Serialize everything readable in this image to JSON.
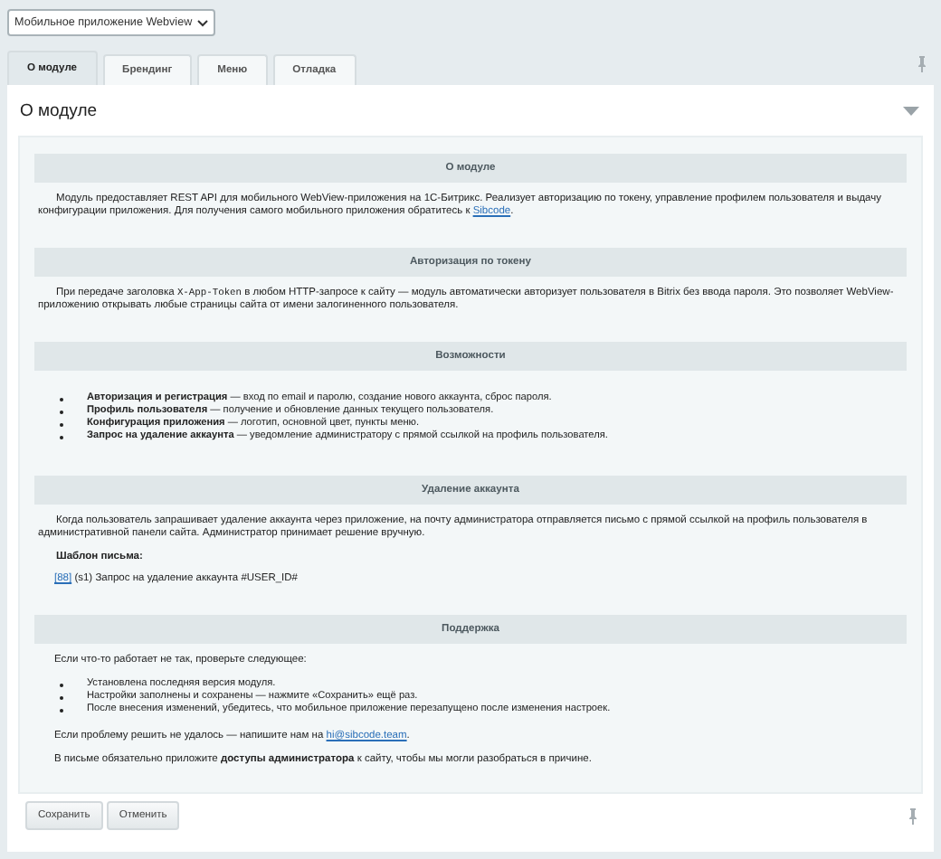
{
  "module_select": {
    "value": "Мобильное приложение Webview"
  },
  "tabs": [
    {
      "label": "О модуле",
      "selected": true
    },
    {
      "label": "Брендинг",
      "selected": false
    },
    {
      "label": "Меню",
      "selected": false
    },
    {
      "label": "Отладка",
      "selected": false
    }
  ],
  "panel": {
    "title": "О модуле"
  },
  "sections": [
    {
      "heading": "О модуле",
      "blocks": [
        {
          "kind": "paragraph",
          "indent": true,
          "parts": [
            {
              "kind": "text",
              "text": "Модуль предоставляет REST API для мобильного WebView-приложения на 1С-Битрикс. Реализует авторизацию по токену, управление профилем пользователя и выдачу конфигурации приложения. Для получения самого мобильного приложения обратитесь к "
            },
            {
              "kind": "link",
              "text": "Sibcode"
            },
            {
              "kind": "text",
              "text": "."
            }
          ]
        }
      ]
    },
    {
      "heading": "Авторизация по токену",
      "blocks": [
        {
          "kind": "paragraph",
          "indent": true,
          "parts": [
            {
              "kind": "text",
              "text": "При передаче заголовка "
            },
            {
              "kind": "code",
              "text": "X-App-Token"
            },
            {
              "kind": "text",
              "text": " в любом HTTP-запросе к сайту — модуль автоматически авторизует пользователя в Bitrix без ввода пароля. Это позволяет WebView-приложению открывать любые страницы сайта от имени залогиненного пользователя."
            }
          ]
        }
      ]
    },
    {
      "heading": "Возможности",
      "blocks": [
        {
          "kind": "list",
          "items": [
            "**Авторизация и регистрация** — вход по email и паролю, создание нового аккаунта, сброс пароля.",
            "**Профиль пользователя** — получение и обновление данных текущего пользователя.",
            "**Конфигурация приложения** — логотип, основной цвет, пункты меню.",
            "**Запрос на удаление аккаунта** — уведомление администратору с прямой ссылкой на профиль пользователя."
          ]
        }
      ]
    },
    {
      "heading": "Удаление аккаунта",
      "blocks": [
        {
          "kind": "paragraph",
          "indent": true,
          "parts": [
            {
              "kind": "text",
              "text": "Когда пользователь запрашивает удаление аккаунта через приложение, на почту администратора отправляется письмо с прямой ссылкой на профиль пользователя в административной панели сайта. Администратор принимает решение вручную."
            }
          ]
        },
        {
          "kind": "label",
          "text": "Шаблон письма:"
        },
        {
          "kind": "paragraph",
          "indent": false,
          "parts": [
            {
              "kind": "link",
              "text": "[88]"
            },
            {
              "kind": "text",
              "text": " (s1) Запрос на удаление аккаунта #USER_ID#"
            }
          ]
        }
      ]
    },
    {
      "heading": "Поддержка",
      "blocks": [
        {
          "kind": "paragraph",
          "indent": false,
          "parts": [
            {
              "kind": "text",
              "text": "Если что-то работает не так, проверьте следующее:"
            }
          ]
        },
        {
          "kind": "list",
          "items": [
            "Установлена последняя версия модуля.",
            "Настройки заполнены и сохранены — нажмите «Сохранить» ещё раз.",
            "После внесения изменений, убедитесь, что мобильное приложение перезапущено после изменения настроек."
          ]
        },
        {
          "kind": "paragraph",
          "indent": false,
          "parts": [
            {
              "kind": "text",
              "text": "Если проблему решить не удалось — напишите нам на "
            },
            {
              "kind": "link",
              "text": "hi@sibcode.team"
            },
            {
              "kind": "text",
              "text": "."
            }
          ]
        },
        {
          "kind": "paragraph",
          "indent": false,
          "parts": [
            {
              "kind": "text",
              "text": "В письме обязательно приложите **доступы администратора** к сайту, чтобы мы могли разобраться в причине."
            }
          ]
        }
      ]
    }
  ],
  "buttons": [
    "Сохранить",
    "Отменить"
  ]
}
